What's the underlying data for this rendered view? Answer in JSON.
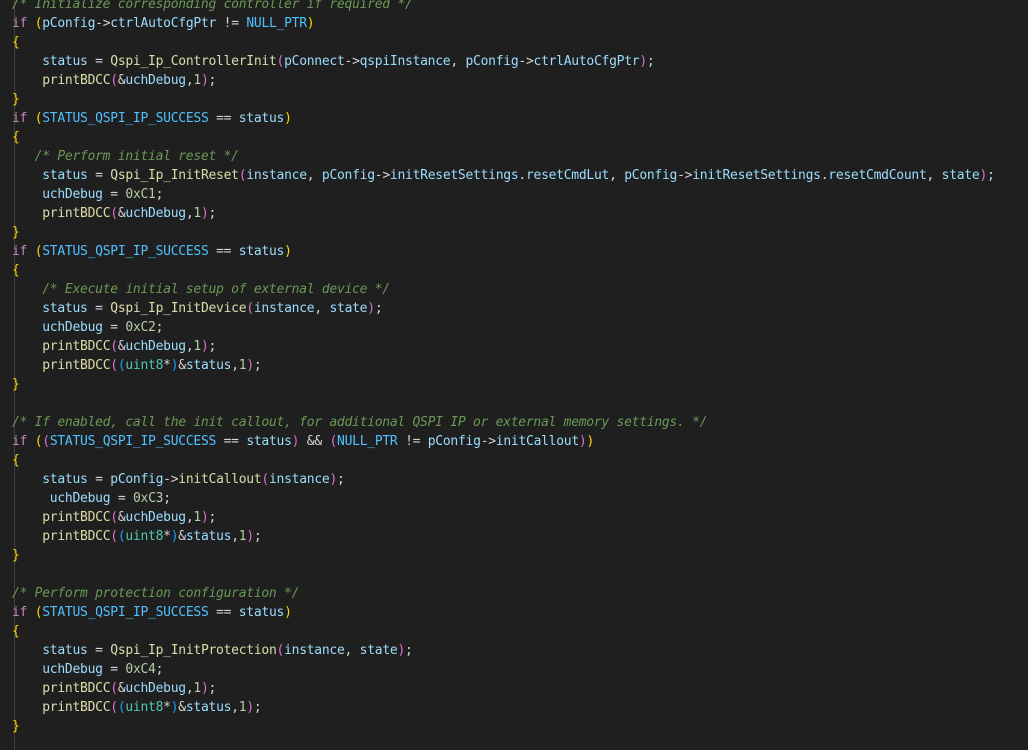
{
  "editor": {
    "language": "c",
    "lines": [
      [
        [
          "c",
          "/* Initialize corresponding controller if required */"
        ]
      ],
      [
        [
          "k",
          "if"
        ],
        [
          "p",
          " "
        ],
        [
          "b1",
          "("
        ],
        [
          "v",
          "pConfig"
        ],
        [
          "o",
          "->"
        ],
        [
          "v",
          "ctrlAutoCfgPtr"
        ],
        [
          "p",
          " "
        ],
        [
          "o",
          "!="
        ],
        [
          "p",
          " "
        ],
        [
          "m",
          "NULL_PTR"
        ],
        [
          "b1",
          ")"
        ]
      ],
      [
        [
          "b1",
          "{"
        ]
      ],
      [
        [
          "p",
          "    "
        ],
        [
          "v",
          "status"
        ],
        [
          "p",
          " "
        ],
        [
          "o",
          "="
        ],
        [
          "p",
          " "
        ],
        [
          "f",
          "Qspi_Ip_ControllerInit"
        ],
        [
          "b2",
          "("
        ],
        [
          "v",
          "pConnect"
        ],
        [
          "o",
          "->"
        ],
        [
          "v",
          "qspiInstance"
        ],
        [
          "p",
          ", "
        ],
        [
          "v",
          "pConfig"
        ],
        [
          "o",
          "->"
        ],
        [
          "v",
          "ctrlAutoCfgPtr"
        ],
        [
          "b2",
          ")"
        ],
        [
          "p",
          ";"
        ]
      ],
      [
        [
          "p",
          "    "
        ],
        [
          "f",
          "printBDCC"
        ],
        [
          "b2",
          "("
        ],
        [
          "o",
          "&"
        ],
        [
          "v",
          "uchDebug"
        ],
        [
          "p",
          ","
        ],
        [
          "n",
          "1"
        ],
        [
          "b2",
          ")"
        ],
        [
          "p",
          ";"
        ]
      ],
      [
        [
          "b1",
          "}"
        ]
      ],
      [
        [
          "k",
          "if"
        ],
        [
          "p",
          " "
        ],
        [
          "b1",
          "("
        ],
        [
          "m",
          "STATUS_QSPI_IP_SUCCESS"
        ],
        [
          "p",
          " "
        ],
        [
          "o",
          "=="
        ],
        [
          "p",
          " "
        ],
        [
          "v",
          "status"
        ],
        [
          "b1",
          ")"
        ]
      ],
      [
        [
          "b1",
          "{"
        ]
      ],
      [
        [
          "p",
          "   "
        ],
        [
          "c",
          "/* Perform initial reset */"
        ]
      ],
      [
        [
          "p",
          "    "
        ],
        [
          "v",
          "status"
        ],
        [
          "p",
          " "
        ],
        [
          "o",
          "="
        ],
        [
          "p",
          " "
        ],
        [
          "f",
          "Qspi_Ip_InitReset"
        ],
        [
          "b2",
          "("
        ],
        [
          "v",
          "instance"
        ],
        [
          "p",
          ", "
        ],
        [
          "v",
          "pConfig"
        ],
        [
          "o",
          "->"
        ],
        [
          "v",
          "initResetSettings"
        ],
        [
          "p",
          "."
        ],
        [
          "v",
          "resetCmdLut"
        ],
        [
          "p",
          ", "
        ],
        [
          "v",
          "pConfig"
        ],
        [
          "o",
          "->"
        ],
        [
          "v",
          "initResetSettings"
        ],
        [
          "p",
          "."
        ],
        [
          "v",
          "resetCmdCount"
        ],
        [
          "p",
          ", "
        ],
        [
          "v",
          "state"
        ],
        [
          "b2",
          ")"
        ],
        [
          "p",
          ";"
        ]
      ],
      [
        [
          "p",
          "    "
        ],
        [
          "v",
          "uchDebug"
        ],
        [
          "p",
          " "
        ],
        [
          "o",
          "="
        ],
        [
          "p",
          " "
        ],
        [
          "n",
          "0xC1"
        ],
        [
          "p",
          ";"
        ]
      ],
      [
        [
          "p",
          "    "
        ],
        [
          "f",
          "printBDCC"
        ],
        [
          "b2",
          "("
        ],
        [
          "o",
          "&"
        ],
        [
          "v",
          "uchDebug"
        ],
        [
          "p",
          ","
        ],
        [
          "n",
          "1"
        ],
        [
          "b2",
          ")"
        ],
        [
          "p",
          ";"
        ]
      ],
      [
        [
          "b1",
          "}"
        ]
      ],
      [
        [
          "k",
          "if"
        ],
        [
          "p",
          " "
        ],
        [
          "b1",
          "("
        ],
        [
          "m",
          "STATUS_QSPI_IP_SUCCESS"
        ],
        [
          "p",
          " "
        ],
        [
          "o",
          "=="
        ],
        [
          "p",
          " "
        ],
        [
          "v",
          "status"
        ],
        [
          "b1",
          ")"
        ]
      ],
      [
        [
          "b1",
          "{"
        ]
      ],
      [
        [
          "p",
          "    "
        ],
        [
          "c",
          "/* Execute initial setup of external device */"
        ]
      ],
      [
        [
          "p",
          "    "
        ],
        [
          "v",
          "status"
        ],
        [
          "p",
          " "
        ],
        [
          "o",
          "="
        ],
        [
          "p",
          " "
        ],
        [
          "f",
          "Qspi_Ip_InitDevice"
        ],
        [
          "b2",
          "("
        ],
        [
          "v",
          "instance"
        ],
        [
          "p",
          ", "
        ],
        [
          "v",
          "state"
        ],
        [
          "b2",
          ")"
        ],
        [
          "p",
          ";"
        ]
      ],
      [
        [
          "p",
          "    "
        ],
        [
          "v",
          "uchDebug"
        ],
        [
          "p",
          " "
        ],
        [
          "o",
          "="
        ],
        [
          "p",
          " "
        ],
        [
          "n",
          "0xC2"
        ],
        [
          "p",
          ";"
        ]
      ],
      [
        [
          "p",
          "    "
        ],
        [
          "f",
          "printBDCC"
        ],
        [
          "b2",
          "("
        ],
        [
          "o",
          "&"
        ],
        [
          "v",
          "uchDebug"
        ],
        [
          "p",
          ","
        ],
        [
          "n",
          "1"
        ],
        [
          "b2",
          ")"
        ],
        [
          "p",
          ";"
        ]
      ],
      [
        [
          "p",
          "    "
        ],
        [
          "f",
          "printBDCC"
        ],
        [
          "b2",
          "("
        ],
        [
          "b3",
          "("
        ],
        [
          "t",
          "uint8"
        ],
        [
          "o",
          "*"
        ],
        [
          "b3",
          ")"
        ],
        [
          "o",
          "&"
        ],
        [
          "v",
          "status"
        ],
        [
          "p",
          ","
        ],
        [
          "n",
          "1"
        ],
        [
          "b2",
          ")"
        ],
        [
          "p",
          ";"
        ]
      ],
      [
        [
          "b1",
          "}"
        ]
      ],
      [],
      [
        [
          "c",
          "/* If enabled, call the init callout, for additional QSPI IP or external memory settings. */"
        ]
      ],
      [
        [
          "k",
          "if"
        ],
        [
          "p",
          " "
        ],
        [
          "b1",
          "("
        ],
        [
          "b2",
          "("
        ],
        [
          "m",
          "STATUS_QSPI_IP_SUCCESS"
        ],
        [
          "p",
          " "
        ],
        [
          "o",
          "=="
        ],
        [
          "p",
          " "
        ],
        [
          "v",
          "status"
        ],
        [
          "b2",
          ")"
        ],
        [
          "p",
          " "
        ],
        [
          "o",
          "&&"
        ],
        [
          "p",
          " "
        ],
        [
          "b2",
          "("
        ],
        [
          "m",
          "NULL_PTR"
        ],
        [
          "p",
          " "
        ],
        [
          "o",
          "!="
        ],
        [
          "p",
          " "
        ],
        [
          "v",
          "pConfig"
        ],
        [
          "o",
          "->"
        ],
        [
          "v",
          "initCallout"
        ],
        [
          "b2",
          ")"
        ],
        [
          "b1",
          ")"
        ]
      ],
      [
        [
          "b1",
          "{"
        ]
      ],
      [
        [
          "p",
          "    "
        ],
        [
          "v",
          "status"
        ],
        [
          "p",
          " "
        ],
        [
          "o",
          "="
        ],
        [
          "p",
          " "
        ],
        [
          "v",
          "pConfig"
        ],
        [
          "o",
          "->"
        ],
        [
          "f",
          "initCallout"
        ],
        [
          "b2",
          "("
        ],
        [
          "v",
          "instance"
        ],
        [
          "b2",
          ")"
        ],
        [
          "p",
          ";"
        ]
      ],
      [
        [
          "p",
          "     "
        ],
        [
          "v",
          "uchDebug"
        ],
        [
          "p",
          " "
        ],
        [
          "o",
          "="
        ],
        [
          "p",
          " "
        ],
        [
          "n",
          "0xC3"
        ],
        [
          "p",
          ";"
        ]
      ],
      [
        [
          "p",
          "    "
        ],
        [
          "f",
          "printBDCC"
        ],
        [
          "b2",
          "("
        ],
        [
          "o",
          "&"
        ],
        [
          "v",
          "uchDebug"
        ],
        [
          "p",
          ","
        ],
        [
          "n",
          "1"
        ],
        [
          "b2",
          ")"
        ],
        [
          "p",
          ";"
        ]
      ],
      [
        [
          "p",
          "    "
        ],
        [
          "f",
          "printBDCC"
        ],
        [
          "b2",
          "("
        ],
        [
          "b3",
          "("
        ],
        [
          "t",
          "uint8"
        ],
        [
          "o",
          "*"
        ],
        [
          "b3",
          ")"
        ],
        [
          "o",
          "&"
        ],
        [
          "v",
          "status"
        ],
        [
          "p",
          ","
        ],
        [
          "n",
          "1"
        ],
        [
          "b2",
          ")"
        ],
        [
          "p",
          ";"
        ]
      ],
      [
        [
          "b1",
          "}"
        ]
      ],
      [],
      [
        [
          "c",
          "/* Perform protection configuration */"
        ]
      ],
      [
        [
          "k",
          "if"
        ],
        [
          "p",
          " "
        ],
        [
          "b1",
          "("
        ],
        [
          "m",
          "STATUS_QSPI_IP_SUCCESS"
        ],
        [
          "p",
          " "
        ],
        [
          "o",
          "=="
        ],
        [
          "p",
          " "
        ],
        [
          "v",
          "status"
        ],
        [
          "b1",
          ")"
        ]
      ],
      [
        [
          "b1",
          "{"
        ]
      ],
      [
        [
          "p",
          "    "
        ],
        [
          "v",
          "status"
        ],
        [
          "p",
          " "
        ],
        [
          "o",
          "="
        ],
        [
          "p",
          " "
        ],
        [
          "f",
          "Qspi_Ip_InitProtection"
        ],
        [
          "b2",
          "("
        ],
        [
          "v",
          "instance"
        ],
        [
          "p",
          ", "
        ],
        [
          "v",
          "state"
        ],
        [
          "b2",
          ")"
        ],
        [
          "p",
          ";"
        ]
      ],
      [
        [
          "p",
          "    "
        ],
        [
          "v",
          "uchDebug"
        ],
        [
          "p",
          " "
        ],
        [
          "o",
          "="
        ],
        [
          "p",
          " "
        ],
        [
          "n",
          "0xC4"
        ],
        [
          "p",
          ";"
        ]
      ],
      [
        [
          "p",
          "    "
        ],
        [
          "f",
          "printBDCC"
        ],
        [
          "b2",
          "("
        ],
        [
          "o",
          "&"
        ],
        [
          "v",
          "uchDebug"
        ],
        [
          "p",
          ","
        ],
        [
          "n",
          "1"
        ],
        [
          "b2",
          ")"
        ],
        [
          "p",
          ";"
        ]
      ],
      [
        [
          "p",
          "    "
        ],
        [
          "f",
          "printBDCC"
        ],
        [
          "b2",
          "("
        ],
        [
          "b3",
          "("
        ],
        [
          "t",
          "uint8"
        ],
        [
          "o",
          "*"
        ],
        [
          "b3",
          ")"
        ],
        [
          "o",
          "&"
        ],
        [
          "v",
          "status"
        ],
        [
          "p",
          ","
        ],
        [
          "n",
          "1"
        ],
        [
          "b2",
          ")"
        ],
        [
          "p",
          ";"
        ]
      ],
      [
        [
          "b1",
          "}"
        ]
      ]
    ]
  }
}
